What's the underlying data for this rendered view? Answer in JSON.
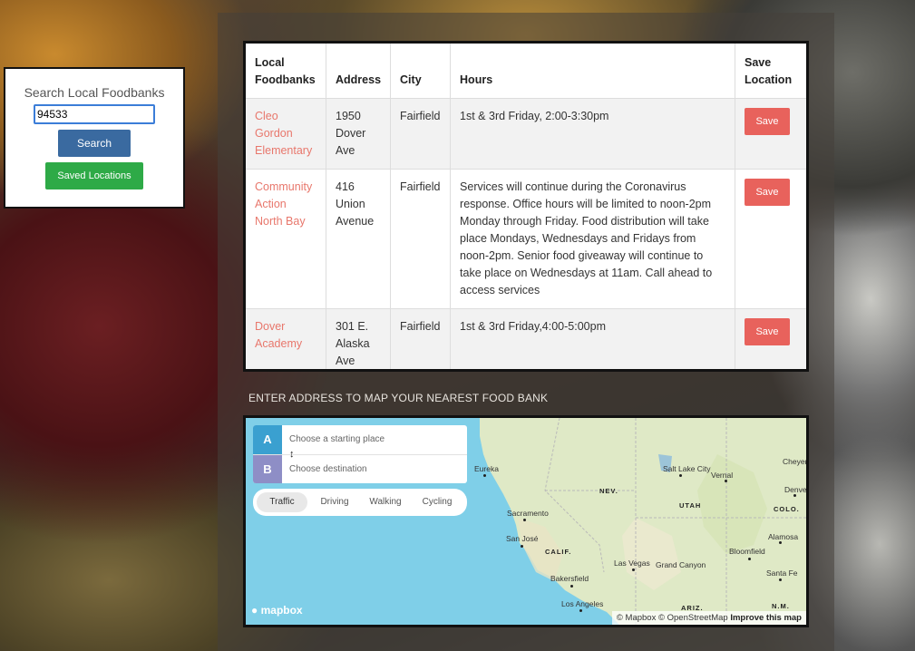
{
  "search": {
    "title": "Search Local Foodbanks",
    "input_value": "94533",
    "search_label": "Search",
    "saved_label": "Saved Locations"
  },
  "table": {
    "headers": [
      "Local Foodbanks",
      "Address",
      "City",
      "Hours",
      "Save Location"
    ],
    "rows": [
      {
        "name": "Cleo Gordon Elementary",
        "address": "1950 Dover Ave",
        "city": "Fairfield",
        "hours": "1st & 3rd Friday, 2:00-3:30pm",
        "save": "Save"
      },
      {
        "name": "Community Action North Bay",
        "address": "416 Union Avenue",
        "city": "Fairfield",
        "hours": "Services will continue during the Coronavirus response. Office hours will be limited to noon-2pm Monday through Friday. Food distribution will take place Mondays, Wednesdays and Fridays from noon-2pm. Senior food giveaway will continue to take place on Wednesdays at 11am. Call ahead to access services",
        "save": "Save"
      },
      {
        "name": "Dover Academy",
        "address": "301 E. Alaska Ave",
        "city": "Fairfield",
        "hours": "1st & 3rd Friday,4:00-5:00pm",
        "save": "Save"
      }
    ]
  },
  "map": {
    "heading": "ENTER ADDRESS TO MAP YOUR NEAREST FOOD BANK",
    "origin_letter": "A",
    "origin_placeholder": "Choose a starting place",
    "dest_letter": "B",
    "dest_placeholder": "Choose destination",
    "modes": [
      "Traffic",
      "Driving",
      "Walking",
      "Cycling"
    ],
    "active_mode": "Traffic",
    "cities": [
      "Eureka",
      "Salt Lake City",
      "Vernal",
      "Cheyer",
      "Denve",
      "Sacramento",
      "San José",
      "Las Vegas",
      "Grand Canyon",
      "Bakersfield",
      "Los Angeles",
      "Alamosa",
      "Bloomfield",
      "Santa Fe"
    ],
    "states": [
      "NEV.",
      "UTAH",
      "COLO.",
      "CALIF.",
      "ARIZ.",
      "N.M."
    ],
    "logo": "mapbox",
    "attribution": "© Mapbox © OpenStreetMap",
    "improve": "Improve this map",
    "colors": {
      "origin": "#3aa0d0",
      "dest": "#8e8ec6",
      "water": "#7fcfe8",
      "land": "#dfe9c6"
    }
  }
}
